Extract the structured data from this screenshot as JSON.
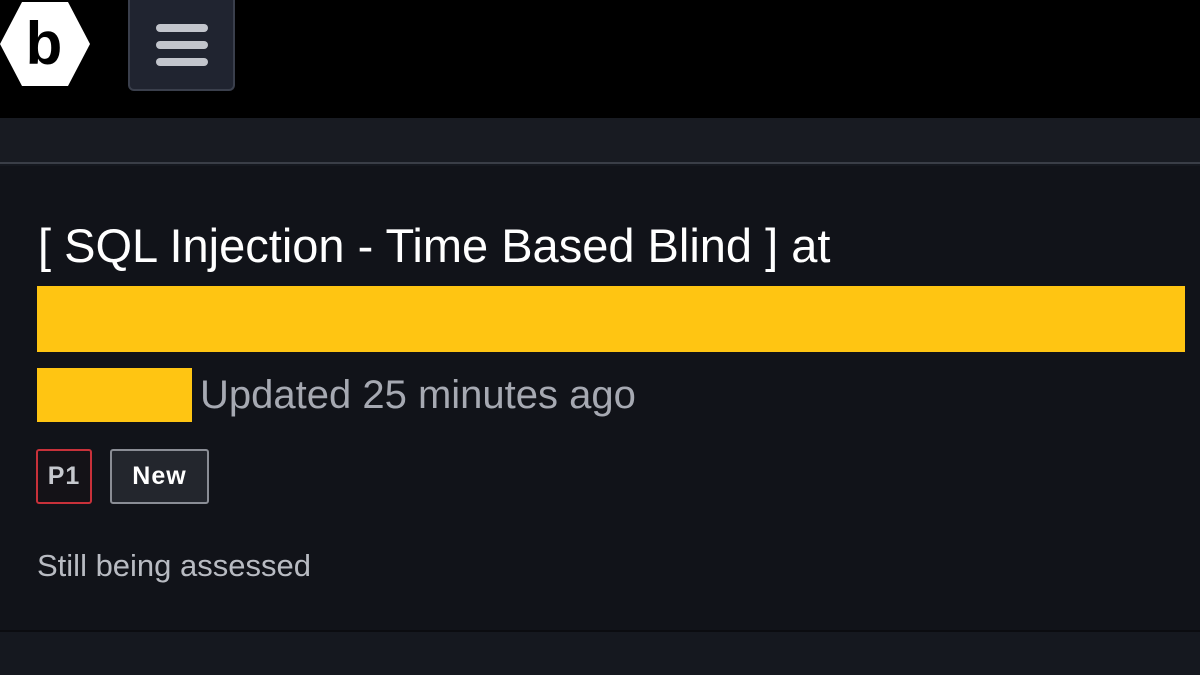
{
  "header": {
    "logo_icon": "bugcrowd-hexagon-logo",
    "logo_letter": "b",
    "menu_icon": "hamburger-menu-icon"
  },
  "submission": {
    "title": "[ SQL Injection - Time Based Blind ] at",
    "updated_text": "Updated 25 minutes ago",
    "priority_badge": "P1",
    "state_badge": "New",
    "status_text": "Still being assessed"
  },
  "colors": {
    "redaction": "#ffc512",
    "priority_border": "#c8313a",
    "background": "#111319"
  }
}
